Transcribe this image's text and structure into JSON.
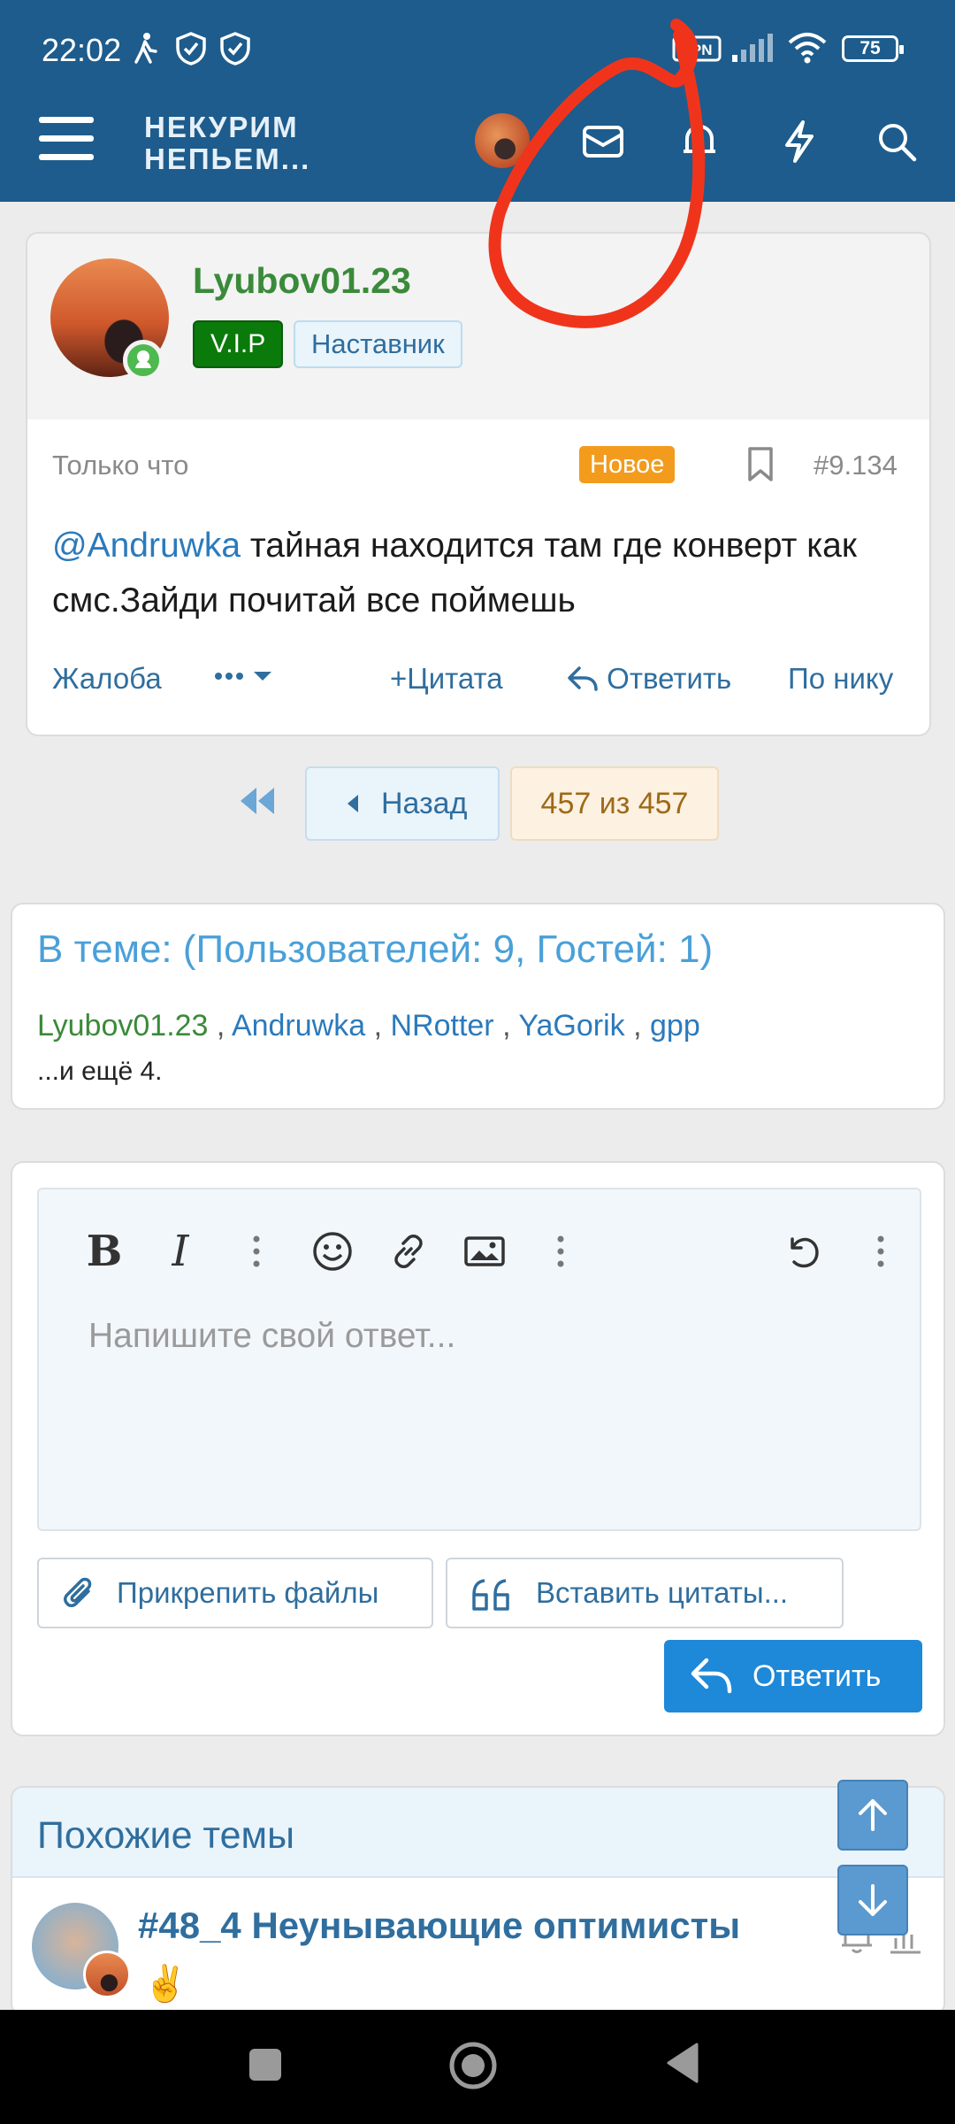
{
  "status_bar": {
    "time": "22:02",
    "icons": [
      "walk-icon",
      "shield-check-icon",
      "shield-check-icon",
      "vpn-icon",
      "signal-icon",
      "wifi-icon"
    ],
    "battery": "75"
  },
  "header": {
    "logo_line1": "НЕКУРИМ",
    "logo_line2": "НЕПЬЕМ...",
    "icons": [
      "menu-icon",
      "avatar",
      "mail-icon",
      "bell-icon",
      "bolt-icon",
      "search-icon"
    ]
  },
  "post": {
    "username": "Lyubov01.23",
    "badge_vip": "V.I.P",
    "badge_role": "Наставник",
    "time": "Только что",
    "new_badge": "Новое",
    "post_number": "#9.134",
    "mention": "@Andruwka",
    "body_text": " тайная находится там где конверт как смс.Зайди почитай все поймешь",
    "actions": {
      "report": "Жалоба",
      "quote": "Цитата",
      "reply": "Ответить",
      "by_nick": "По нику"
    }
  },
  "pagination": {
    "back": "Назад",
    "current": "457 из 457"
  },
  "in_topic": {
    "title": "В теме: (Пользователей: 9, Гостей: 1)",
    "users": [
      "Lyubov01.23",
      "Andruwka",
      "NRotter",
      "YaGorik",
      "gpp"
    ],
    "more": "...и ещё 4."
  },
  "reply_box": {
    "placeholder": "Напишите свой ответ...",
    "attach": "Прикрепить файлы",
    "insert_quotes": "Вставить цитаты...",
    "submit": "Ответить"
  },
  "similar": {
    "title": "Похожие темы",
    "topic": "#48_4 Неунывающие оптимисты",
    "emoji": "✌️"
  },
  "colors": {
    "header_bg": "#1d5c8c",
    "link": "#2f6e9e",
    "vip_green": "#0a7a0a",
    "new_orange": "#f29b1d",
    "primary_button": "#1e88d9",
    "annotation_red": "#f0341c"
  }
}
